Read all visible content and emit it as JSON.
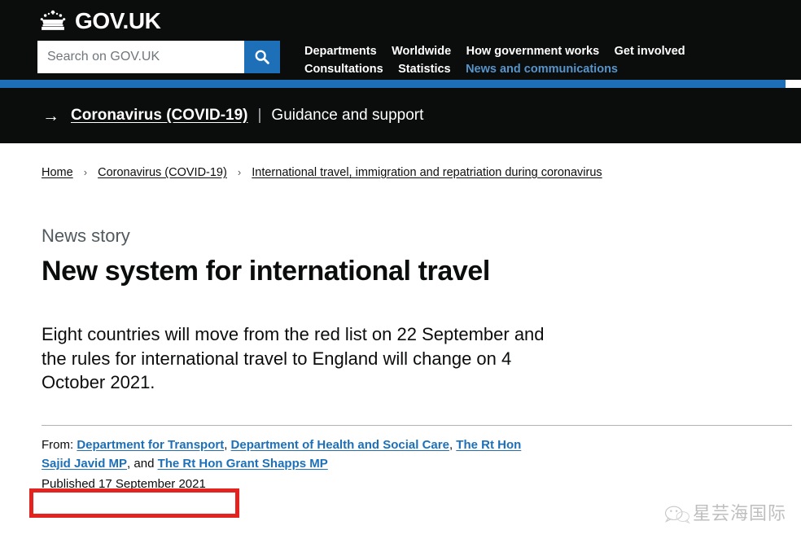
{
  "header": {
    "logo_text": "GOV.UK",
    "crown_icon": "crown-icon",
    "search": {
      "placeholder": "Search on GOV.UK",
      "value": "",
      "button_icon": "search-icon"
    },
    "nav": {
      "line1": [
        {
          "label": "Departments",
          "current": false
        },
        {
          "label": "Worldwide",
          "current": false
        },
        {
          "label": "How government works",
          "current": false
        },
        {
          "label": "Get involved",
          "current": false
        }
      ],
      "line2": [
        {
          "label": "Consultations",
          "current": false
        },
        {
          "label": "Statistics",
          "current": false
        },
        {
          "label": "News and communications",
          "current": true
        }
      ]
    },
    "accent_color": "#1d70b8",
    "background_color": "#0b0c0c",
    "current_nav_color": "#5694ca"
  },
  "covid_banner": {
    "arrow_icon": "arrow-right-icon",
    "link_label": "Coronavirus (COVID-19)",
    "divider": "|",
    "sub_label": "Guidance and support"
  },
  "breadcrumbs": [
    {
      "label": "Home"
    },
    {
      "label": "Coronavirus (COVID-19)"
    },
    {
      "label": "International travel, immigration and repatriation during coronavirus"
    }
  ],
  "breadcrumb_separator": "›",
  "article": {
    "type_label": "News story",
    "title": "New system for international travel",
    "lead": "Eight countries will move from the red list on 22 September and the rules for international travel to England will change on 4 October 2021.",
    "from_prefix": "From:",
    "from_links": [
      "Department for Transport",
      "Department of Health and Social Care",
      "The Rt Hon Sajid Javid MP",
      "The Rt Hon Grant Shapps MP"
    ],
    "from_comma": ",",
    "from_and": ", and ",
    "published": "Published 17 September 2021"
  },
  "annotation": {
    "highlight_color": "#e3231f",
    "target": "published-date"
  },
  "watermark": {
    "icon": "wechat-icon",
    "text": "星芸海国际"
  }
}
